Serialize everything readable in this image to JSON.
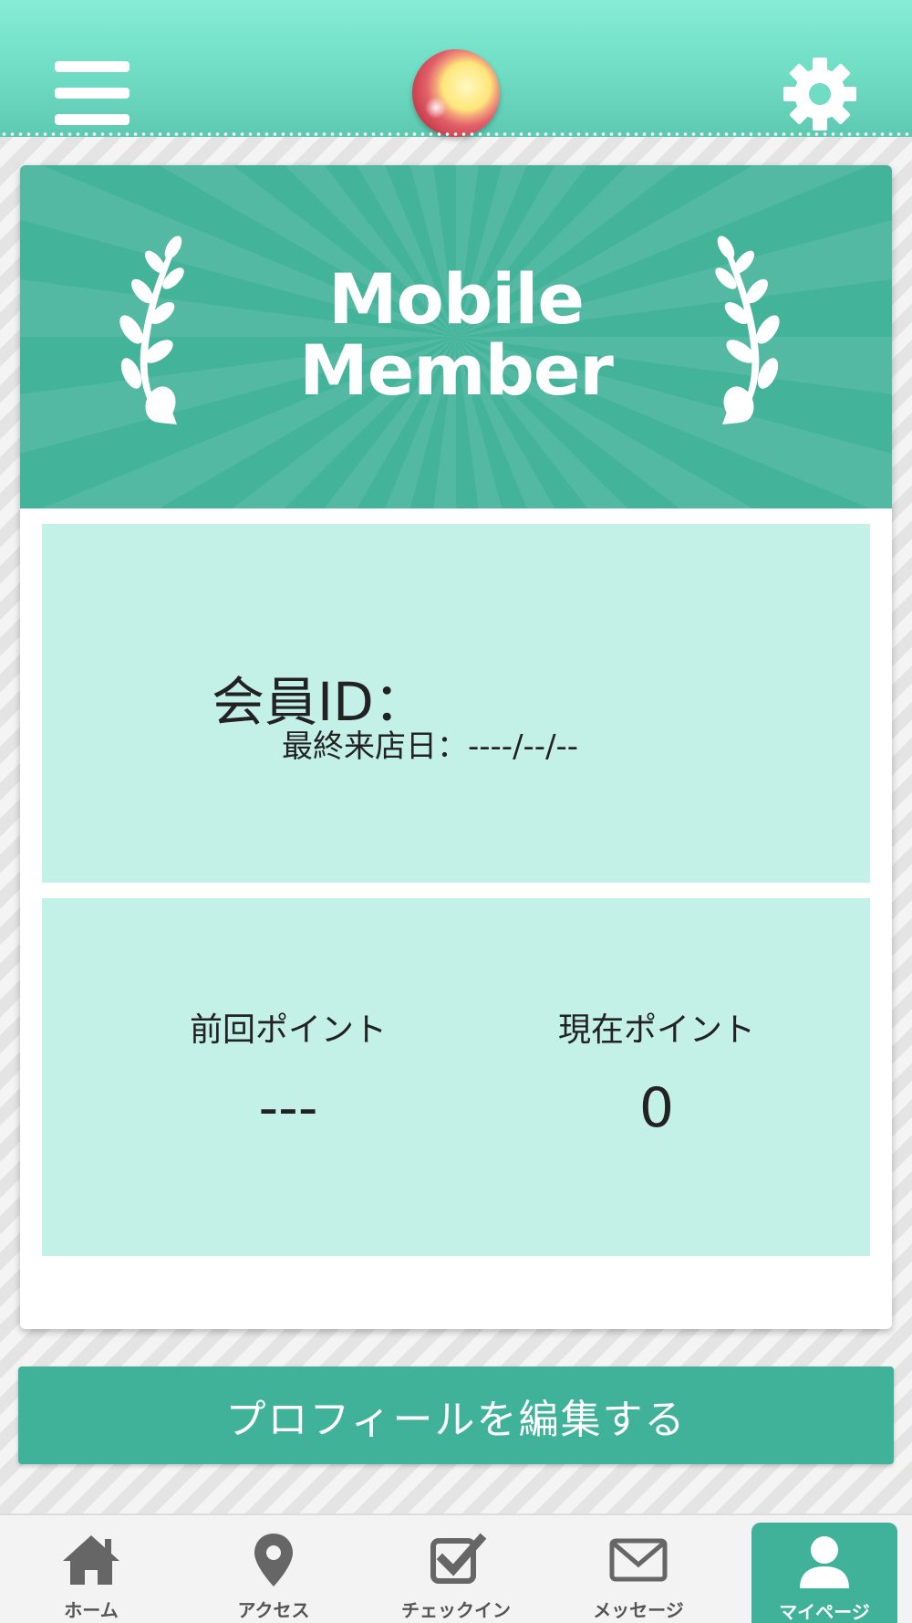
{
  "header": {
    "menu_icon": "hamburger-menu-icon",
    "logo_icon": "round-logo-icon",
    "settings_icon": "gear-icon"
  },
  "banner": {
    "line1": "Mobile",
    "line2": "Member",
    "decoration": "laurel-icon"
  },
  "member": {
    "id_label": "会員ID：",
    "last_visit_label": "最終来店日",
    "last_visit_separator": "：",
    "last_visit_value": "----/--/--"
  },
  "points": {
    "previous_label": "前回ポイント",
    "previous_value": "---",
    "current_label": "現在ポイント",
    "current_value": "0"
  },
  "edit_profile_label": "プロフィールを編集する",
  "nav": {
    "items": [
      {
        "label": "ホーム",
        "icon": "home-icon"
      },
      {
        "label": "アクセス",
        "icon": "map-pin-icon"
      },
      {
        "label": "チェックイン",
        "icon": "checkbox-icon"
      },
      {
        "label": "メッセージ",
        "icon": "envelope-icon"
      },
      {
        "label": "マイページ",
        "icon": "user-icon"
      }
    ],
    "active_index": 4
  },
  "colors": {
    "header_top": "#86ecd6",
    "accent": "#40b299",
    "panel": "#c4f1e7",
    "nav_inactive": "#555555"
  }
}
